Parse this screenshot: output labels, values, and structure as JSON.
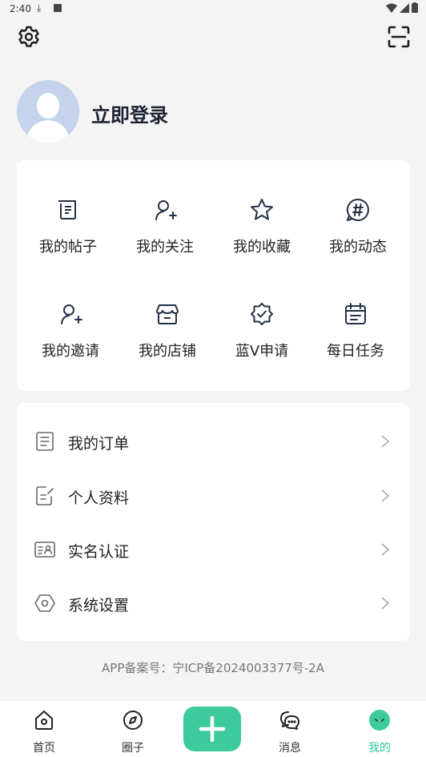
{
  "status_bar": {
    "time": "2:40"
  },
  "header": {
    "login_title": "立即登录"
  },
  "quick_grid": [
    {
      "label": "我的帖子",
      "icon": "posts-icon"
    },
    {
      "label": "我的关注",
      "icon": "follow-icon"
    },
    {
      "label": "我的收藏",
      "icon": "star-icon"
    },
    {
      "label": "我的动态",
      "icon": "hashtag-icon"
    },
    {
      "label": "我的邀请",
      "icon": "invite-icon"
    },
    {
      "label": "我的店铺",
      "icon": "store-icon"
    },
    {
      "label": "蓝V申请",
      "icon": "verified-badge-icon"
    },
    {
      "label": "每日任务",
      "icon": "calendar-icon"
    }
  ],
  "menu_list": [
    {
      "label": "我的订单",
      "icon": "order-icon"
    },
    {
      "label": "个人资料",
      "icon": "profile-edit-icon"
    },
    {
      "label": "实名认证",
      "icon": "id-card-icon"
    },
    {
      "label": "系统设置",
      "icon": "hexagon-settings-icon"
    }
  ],
  "icp": "APP备案号：宁ICP备2024003377号-2A",
  "tabbar": {
    "items": [
      {
        "label": "首页",
        "icon": "home-icon"
      },
      {
        "label": "圈子",
        "icon": "compass-icon"
      },
      {
        "label": "消息",
        "icon": "chat-icon"
      },
      {
        "label": "我的",
        "icon": "mine-face-icon"
      }
    ],
    "active_index": 3,
    "accent": "#3dcb9d"
  }
}
